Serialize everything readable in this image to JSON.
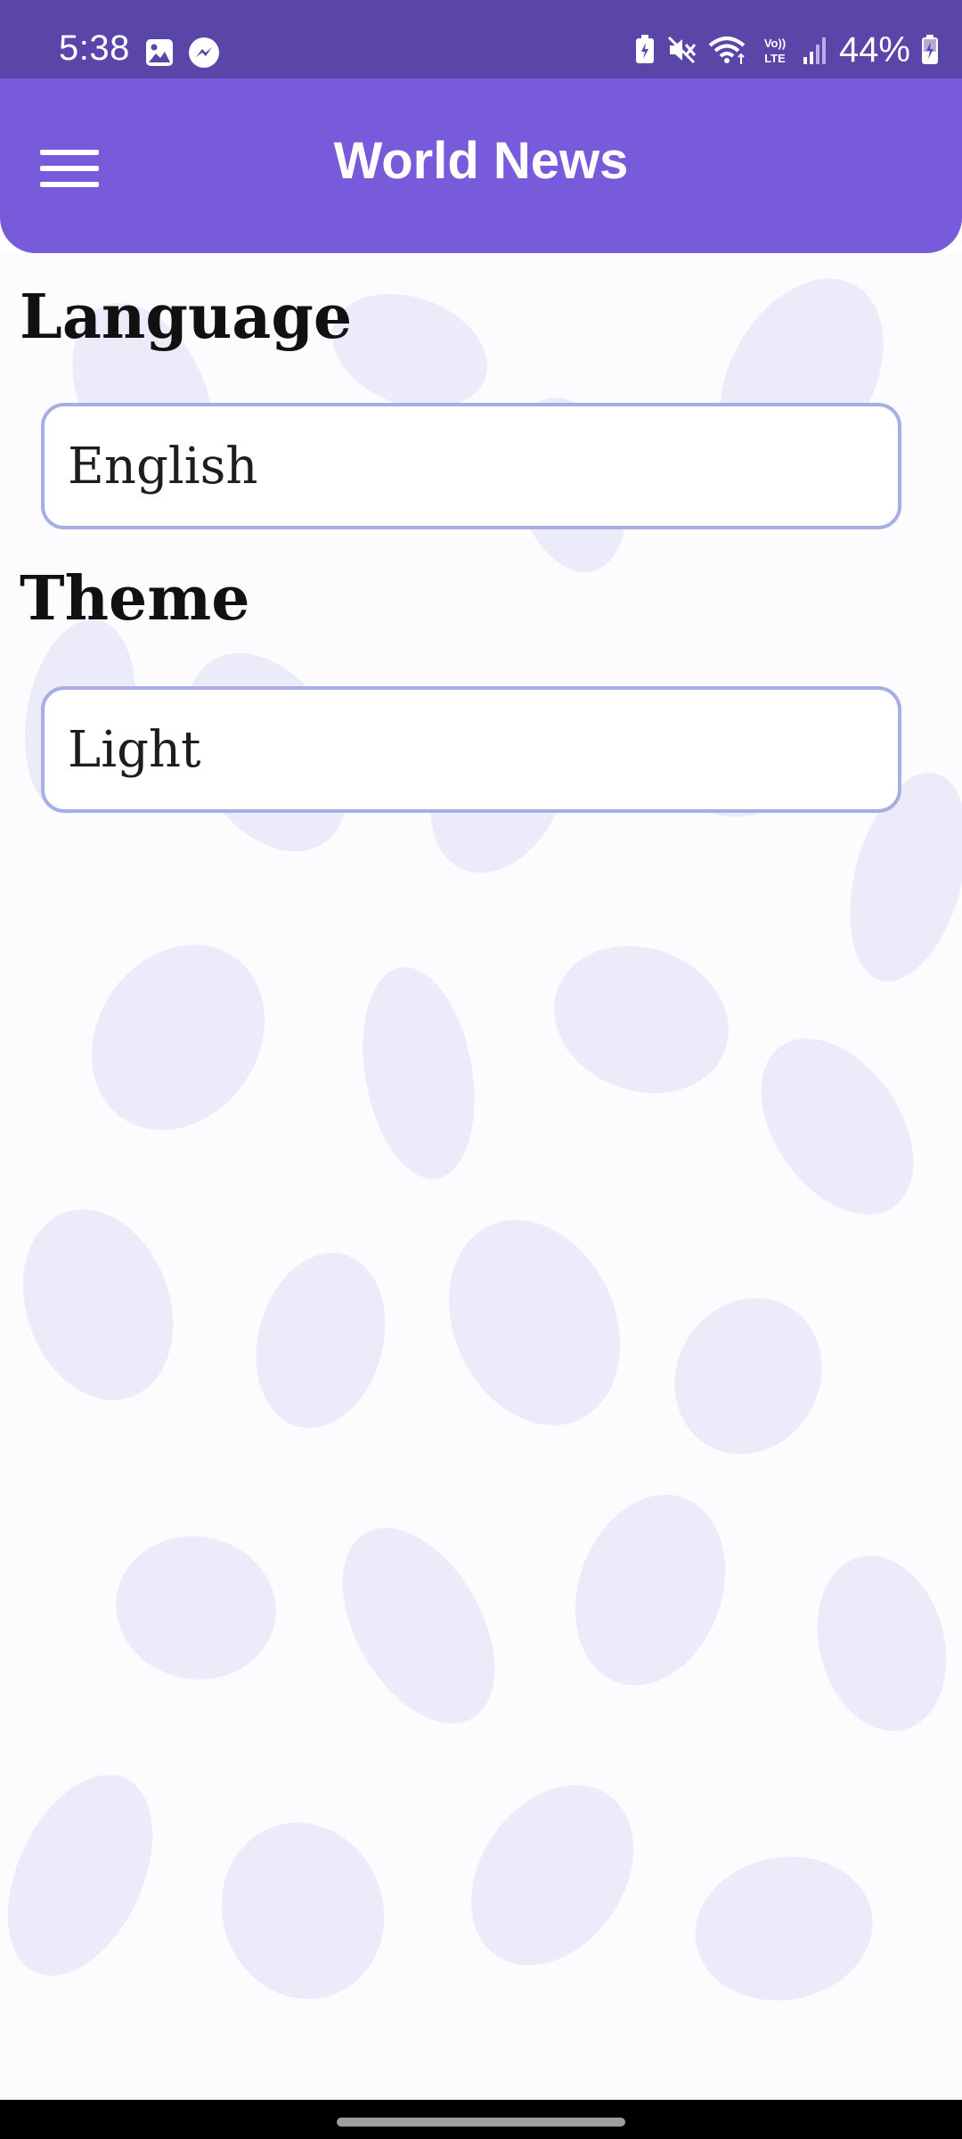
{
  "status_bar": {
    "time": "5:38",
    "battery": "44%",
    "icons": [
      "gallery-icon",
      "messenger-icon",
      "battery-saver-icon",
      "mute-icon",
      "wifi-icon",
      "volte-icon",
      "signal-icon",
      "battery-icon"
    ]
  },
  "app_bar": {
    "title": "World News",
    "menu_icon": "hamburger-menu-icon",
    "background_color": "#775bdb"
  },
  "settings": {
    "language": {
      "label": "Language",
      "value": "English"
    },
    "theme": {
      "label": "Theme",
      "value": "Light"
    }
  },
  "colors": {
    "status_bar": "#5a46a8",
    "field_border": "#a6aee6",
    "nav_bar": "#000000"
  }
}
